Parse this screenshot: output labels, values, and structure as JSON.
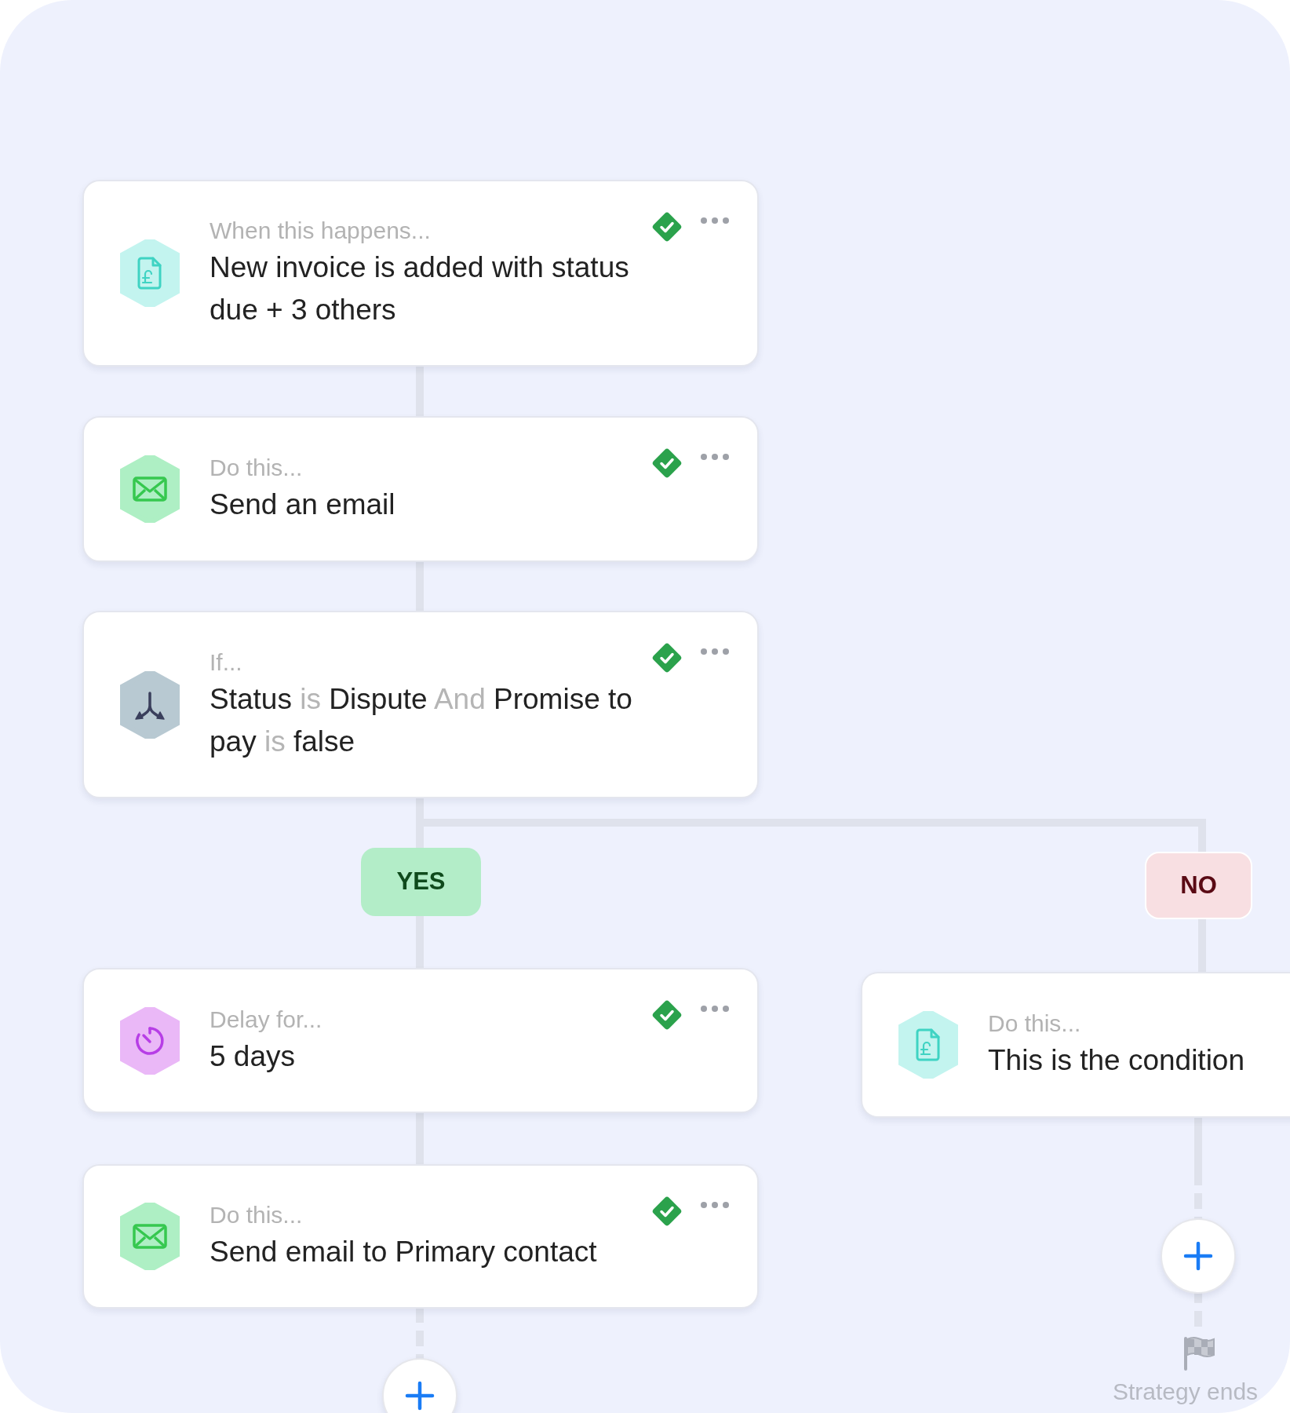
{
  "nodes": [
    {
      "kind": "invoice",
      "label": "When this happens...",
      "text_parts": [
        {
          "text": "New invoice is added with status due + 3 others",
          "muted": false
        }
      ],
      "verified": true
    },
    {
      "kind": "email",
      "label": "Do this...",
      "text_parts": [
        {
          "text": "Send an email",
          "muted": false
        }
      ],
      "verified": true
    },
    {
      "kind": "split",
      "label": "If...",
      "text_parts": [
        {
          "text": "Status",
          "muted": false
        },
        {
          "text": "is",
          "muted": true
        },
        {
          "text": "Dispute",
          "muted": false
        },
        {
          "text": "And",
          "muted": true
        },
        {
          "text": "Promise to pay",
          "muted": false
        },
        {
          "text": "is",
          "muted": true
        },
        {
          "text": "false",
          "muted": false
        }
      ],
      "verified": true
    },
    {
      "kind": "timer",
      "label": "Delay for...",
      "text_parts": [
        {
          "text": "5 days",
          "muted": false
        }
      ],
      "verified": true
    },
    {
      "kind": "email",
      "label": "Do this...",
      "text_parts": [
        {
          "text": "Send email to Primary contact",
          "muted": false
        }
      ],
      "verified": true
    }
  ],
  "branches": [
    {
      "kind": "yes",
      "label": "YES"
    },
    {
      "kind": "no",
      "label": "NO"
    }
  ],
  "branch_node": {
    "kind": "invoice",
    "label": "Do this...",
    "text_parts": [
      {
        "text": "This is the condition",
        "muted": false
      }
    ]
  },
  "end": {
    "label": "Strategy ends"
  }
}
